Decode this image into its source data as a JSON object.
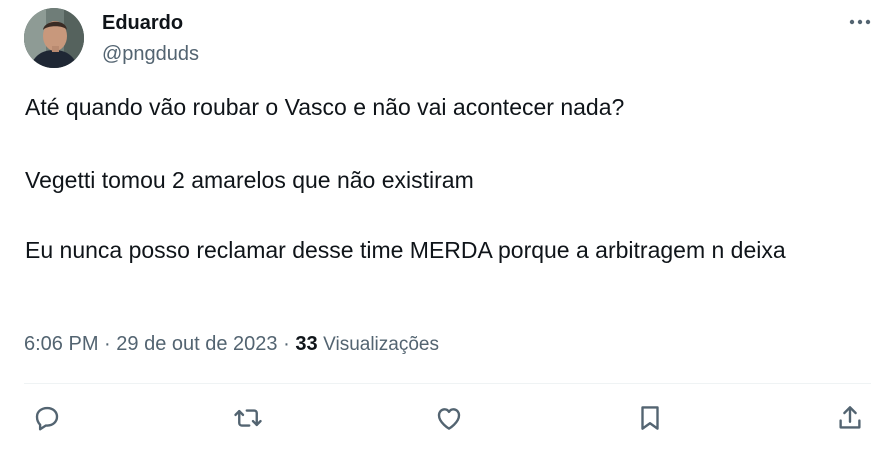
{
  "author": {
    "name": "Eduardo",
    "handle": "@pngduds"
  },
  "tweet": {
    "paragraphs": [
      "Até quando vão roubar o Vasco e não vai acontecer nada?",
      "Vegetti tomou 2 amarelos que não existiram",
      "Eu nunca posso reclamar desse time MERDA porque a arbitragem n deixa"
    ],
    "time": "6:06 PM",
    "date": "29 de out de 2023",
    "separator": "·",
    "views_count": "33",
    "views_label": "Visualizações"
  },
  "icons": {
    "more": "more-horizontal-icon",
    "reply": "reply-icon",
    "retweet": "retweet-icon",
    "like": "heart-icon",
    "bookmark": "bookmark-icon",
    "share": "share-icon"
  },
  "colors": {
    "text_primary": "#0f1419",
    "text_secondary": "#536471",
    "divider": "#eff3f4"
  }
}
